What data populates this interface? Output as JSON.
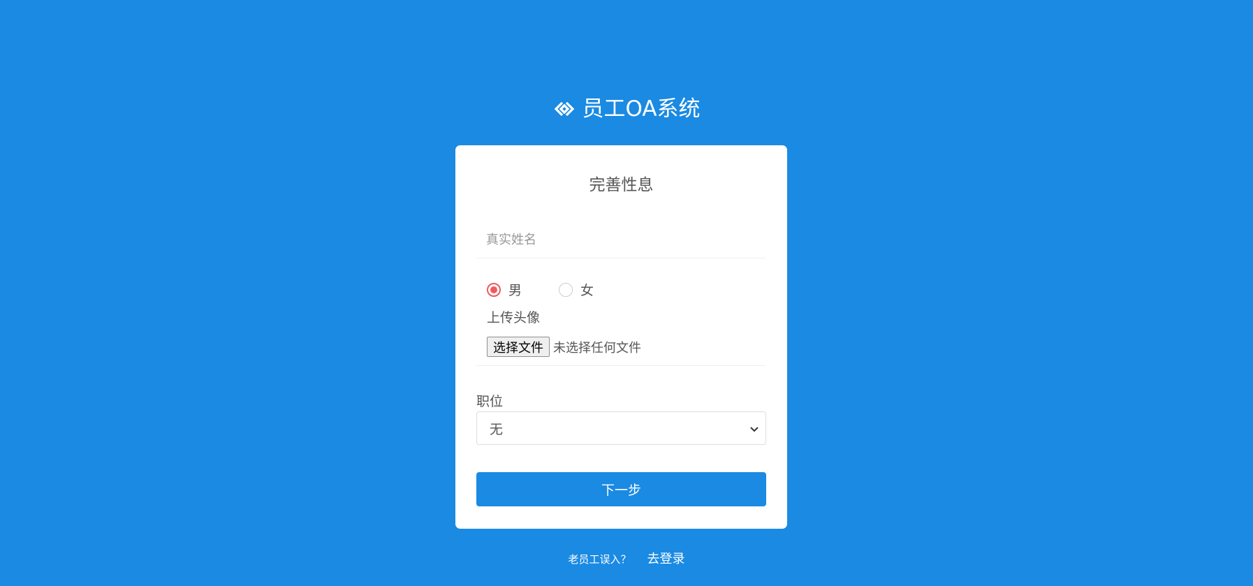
{
  "brand": {
    "title": "员工OA系统",
    "logo_icon": "link-chain-icon"
  },
  "form": {
    "title": "完善性息",
    "name_placeholder": "真实姓名",
    "name_value": "",
    "gender": {
      "options": [
        {
          "label": "男",
          "checked": true
        },
        {
          "label": "女",
          "checked": false
        }
      ]
    },
    "upload": {
      "label": "上传头像",
      "button_label": "选择文件",
      "status": "未选择任何文件"
    },
    "position": {
      "label": "职位",
      "selected": "无",
      "icon": "chevron-down-icon"
    },
    "submit_label": "下一步"
  },
  "footer": {
    "prompt": "老员工误入？",
    "link": "去登录"
  },
  "colors": {
    "background": "#1a8ae3",
    "card": "#ffffff",
    "radio_checked": "#ef5a5f",
    "text": "#555555"
  }
}
